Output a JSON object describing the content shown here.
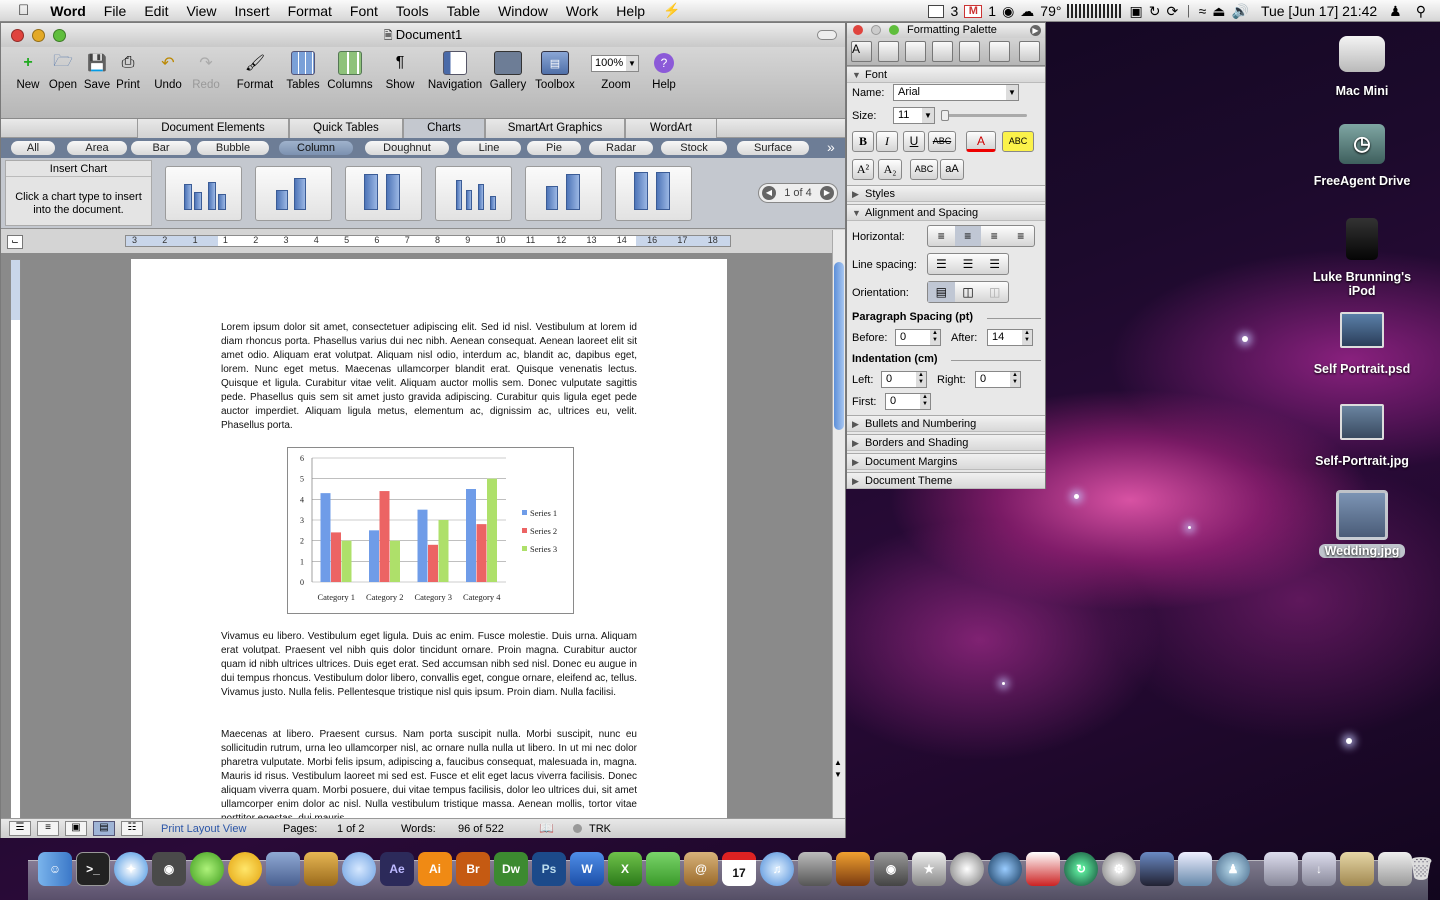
{
  "menubar": {
    "apple": "",
    "app": "Word",
    "items": [
      "File",
      "Edit",
      "View",
      "Insert",
      "Format",
      "Font",
      "Tools",
      "Table",
      "Window",
      "Work",
      "Help"
    ],
    "status": {
      "cal_day": "3",
      "mail_count": "1",
      "temp": "79°",
      "datetime": "Tue [Jun 17] 21:42"
    }
  },
  "window": {
    "title": "Document1"
  },
  "toolbar": {
    "new": "New",
    "open": "Open",
    "save": "Save",
    "print": "Print",
    "undo": "Undo",
    "redo": "Redo",
    "format": "Format",
    "tables": "Tables",
    "columns": "Columns",
    "show": "Show",
    "navigation": "Navigation",
    "gallery": "Gallery",
    "toolbox": "Toolbox",
    "zoom_value": "100%",
    "zoom": "Zoom",
    "help": "Help"
  },
  "ribbon": {
    "tabs": [
      "Document Elements",
      "Quick Tables",
      "Charts",
      "SmartArt Graphics",
      "WordArt"
    ]
  },
  "chart_types": [
    "All",
    "Area",
    "Bar",
    "Bubble",
    "Column",
    "Doughnut",
    "Line",
    "Pie",
    "Radar",
    "Stock",
    "Surface"
  ],
  "insert_chart": {
    "title": "Insert Chart",
    "hint": "Click a chart type to insert into the document.",
    "pager": "1 of 4"
  },
  "ruler": {
    "numbers": [
      "3",
      "2",
      "1",
      "1",
      "2",
      "3",
      "4",
      "5",
      "6",
      "7",
      "8",
      "9",
      "10",
      "11",
      "12",
      "13",
      "14",
      "16",
      "17",
      "18"
    ]
  },
  "document": {
    "p1": "Lorem ipsum dolor sit amet, consectetuer adipiscing elit. Sed id nisl. Vestibulum at lorem id diam rhoncus porta. Phasellus varius dui nec nibh. Aenean consequat. Aenean laoreet elit sit amet odio. Aliquam erat volutpat. Aliquam nisl odio, interdum ac, blandit ac, dapibus eget, lorem. Nunc eget metus. Maecenas ullamcorper blandit erat. Quisque venenatis lectus. Quisque et ligula. Curabitur vitae velit. Aliquam auctor mollis sem. Donec vulputate sagittis pede. Phasellus quis sem sit amet justo gravida adipiscing. Curabitur quis ligula eget pede auctor imperdiet. Aliquam ligula metus, elementum ac, dignissim ac, ultrices eu, velit. Phasellus porta.",
    "p2": "Vivamus eu libero. Vestibulum eget ligula. Duis ac enim. Fusce molestie. Duis urna. Aliquam erat volutpat. Praesent vel nibh quis dolor tincidunt ornare. Proin magna. Curabitur auctor quam id nibh ultrices ultrices. Duis eget erat. Sed accumsan nibh sed nisl. Donec eu augue in dui tempus rhoncus. Vestibulum dolor libero, convallis eget, congue ornare, eleifend ac, tellus. Vivamus justo. Nulla felis. Pellentesque tristique nisl quis ipsum. Proin diam. Nulla facilisi.",
    "p3": "Maecenas at libero. Praesent cursus. Nam porta suscipit nulla. Morbi suscipit, nunc eu sollicitudin rutrum, urna leo ullamcorper nisl, ac ornare nulla nulla ut libero. In ut mi nec dolor pharetra vulputate. Morbi felis ipsum, adipiscing a, faucibus consequat, malesuada in, magna. Mauris id risus. Vestibulum laoreet mi sed est. Fusce et elit eget lacus viverra facilisis. Donec aliquam viverra quam. Morbi posuere, dui vitae tempus facilisis, dolor leo ultrices dui, sit amet ullamcorper enim dolor ac nisl. Nulla vestibulum tristique massa. Aenean mollis, tortor vitae porttitor egestas, dui mauris"
  },
  "chart_data": {
    "type": "bar",
    "categories": [
      "Category 1",
      "Category 2",
      "Category 3",
      "Category 4"
    ],
    "series": [
      {
        "name": "Series 1",
        "values": [
          4.3,
          2.5,
          3.5,
          4.5
        ],
        "color": "#6f9ce8"
      },
      {
        "name": "Series 2",
        "values": [
          2.4,
          4.4,
          1.8,
          2.8
        ],
        "color": "#ec6464"
      },
      {
        "name": "Series 3",
        "values": [
          2,
          2,
          3,
          5
        ],
        "color": "#aee06a"
      }
    ],
    "ylim": [
      0,
      6
    ],
    "yticks": [
      "0",
      "1",
      "2",
      "3",
      "4",
      "5",
      "6"
    ],
    "legend": "right",
    "grid": true
  },
  "statusbar": {
    "view": "Print Layout View",
    "pages_label": "Pages:",
    "pages": "1 of 2",
    "words_label": "Words:",
    "words": "96 of 522",
    "trk": "TRK"
  },
  "palette": {
    "title": "Formatting Palette",
    "font_section": "Font",
    "name_label": "Name:",
    "font_name": "Arial",
    "size_label": "Size:",
    "font_size": "11",
    "bold": "B",
    "italic": "I",
    "underline": "U",
    "strike": "ABC",
    "fontcolor": "A",
    "highlight": "ABC",
    "superscript": "A²",
    "subscript": "A₂",
    "smallcaps": "ABC",
    "changecase": "aA",
    "styles": "Styles",
    "align_section": "Alignment and Spacing",
    "horizontal": "Horizontal:",
    "linespacing": "Line spacing:",
    "orientation": "Orientation:",
    "para_spacing": "Paragraph Spacing (pt)",
    "before": "Before:",
    "before_val": "0",
    "after": "After:",
    "after_val": "14",
    "indentation": "Indentation (cm)",
    "left": "Left:",
    "left_val": "0",
    "right": "Right:",
    "right_val": "0",
    "first": "First:",
    "first_val": "0",
    "bullets": "Bullets and Numbering",
    "borders": "Borders and Shading",
    "margins": "Document Margins",
    "theme": "Document Theme"
  },
  "desktop": {
    "icons": [
      "Mac Mini",
      "FreeAgent Drive",
      "Luke Brunning's iPod",
      "Self Portrait.psd",
      "Self-Portrait.jpg",
      "Wedding.jpg"
    ]
  },
  "dock": {
    "ae": "Ae",
    "ai": "Ai",
    "br": "Br",
    "dw": "Dw",
    "ps": "Ps",
    "cal": "17"
  }
}
